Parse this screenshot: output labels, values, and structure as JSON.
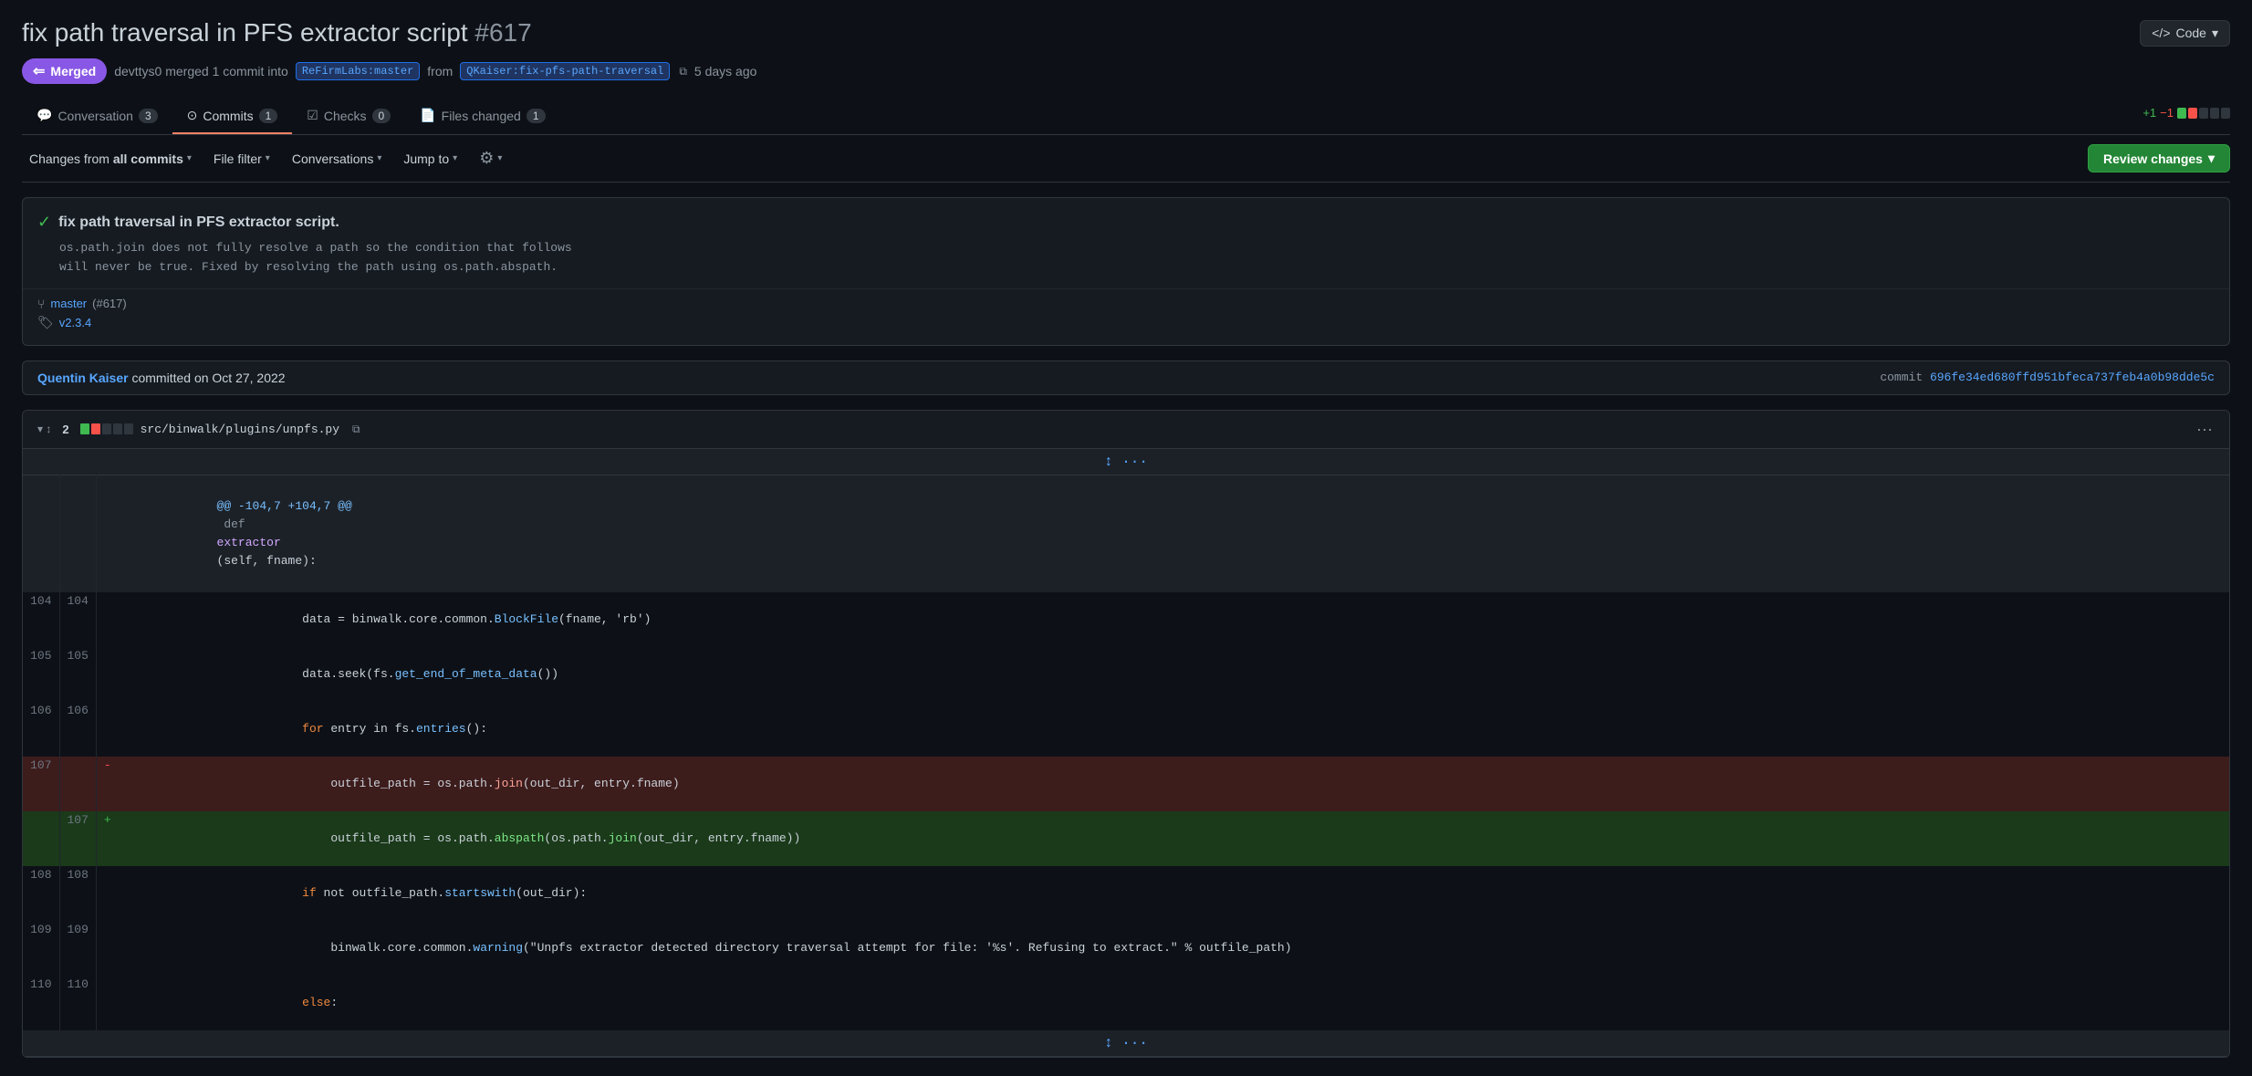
{
  "header": {
    "title": "fix path traversal in PFS extractor script",
    "pr_number": "#617",
    "code_button": "Code"
  },
  "pr_meta": {
    "merged_label": "Merged",
    "merge_icon": "⇐",
    "description": "devttys0 merged 1 commit into",
    "base_branch": "ReFirmLabs:master",
    "from_text": "from",
    "head_branch": "QKaiser:fix-pfs-path-traversal",
    "time_ago": "5 days ago"
  },
  "tabs": [
    {
      "icon": "💬",
      "label": "Conversation",
      "count": "3",
      "active": false
    },
    {
      "icon": "⊙",
      "label": "Commits",
      "count": "1",
      "active": true
    },
    {
      "icon": "☑",
      "label": "Checks",
      "count": "0",
      "active": false
    },
    {
      "icon": "📄",
      "label": "Files changed",
      "count": "1",
      "active": false
    }
  ],
  "diff_stats": {
    "plus": "+1",
    "minus": "−1"
  },
  "toolbar": {
    "changes_from": "Changes from",
    "all_commits": "all commits",
    "file_filter": "File filter",
    "conversations": "Conversations",
    "jump_to": "Jump to",
    "review_changes": "Review changes"
  },
  "commit_box": {
    "check_icon": "✓",
    "title": "fix path traversal in PFS extractor script.",
    "body_line1": "os.path.join does not fully resolve a path so the condition that follows",
    "body_line2": "will never be true. Fixed by resolving the path using os.path.abspath.",
    "ref_branch_icon": "⑂",
    "ref_branch": "master",
    "ref_pr": "(#617)",
    "ref_tag_icon": "🏷",
    "ref_tag": "v2.3.4"
  },
  "commit_info": {
    "author": "Quentin Kaiser",
    "action": "committed on",
    "date": "Oct 27, 2022",
    "commit_label": "commit",
    "commit_hash": "696fe34ed680ffd951bfeca737feb4a0b98dde5c"
  },
  "file_diff": {
    "file_path": "src/binwalk/plugins/unpfs.py",
    "stat_num": "2",
    "hunk_header": "@@ -104,7 +104,7 @@ def extractor(self, fname):",
    "lines": [
      {
        "type": "context",
        "old_num": "104",
        "new_num": "104",
        "content": "            data = binwalk.core.common.BlockFile(fname, 'rb')"
      },
      {
        "type": "context",
        "old_num": "105",
        "new_num": "105",
        "content": "            data.seek(fs.get_end_of_meta_data())"
      },
      {
        "type": "context",
        "old_num": "106",
        "new_num": "106",
        "content": "            for entry in fs.entries():"
      },
      {
        "type": "removed",
        "old_num": "107",
        "new_num": "",
        "content": "                outfile_path = os.path.join(out_dir, entry.fname)"
      },
      {
        "type": "added",
        "old_num": "",
        "new_num": "107",
        "content": "                outfile_path = os.path.abspath(os.path.join(out_dir, entry.fname))"
      },
      {
        "type": "context",
        "old_num": "108",
        "new_num": "108",
        "content": "            if not outfile_path.startswith(out_dir):"
      },
      {
        "type": "context",
        "old_num": "109",
        "new_num": "109",
        "content": "                binwalk.core.common.warning(\"Unpfs extractor detected directory traversal attempt for file: '%s'. Refusing to extract.\" % outfile_path)"
      },
      {
        "type": "context",
        "old_num": "110",
        "new_num": "110",
        "content": "            else:"
      }
    ]
  }
}
